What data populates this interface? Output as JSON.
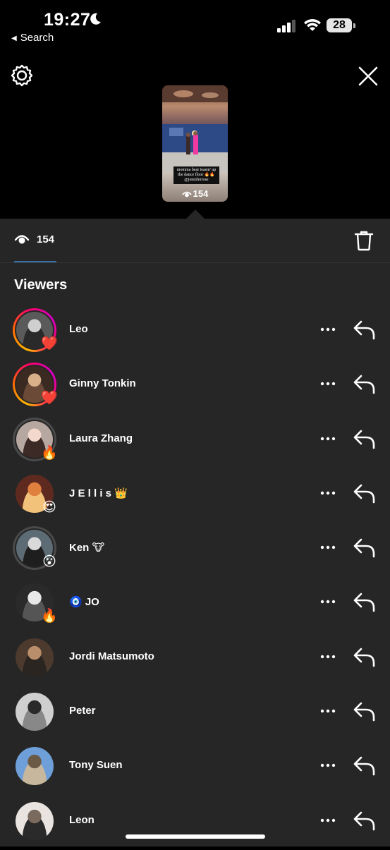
{
  "status": {
    "time": "19:27",
    "back_label": "Search",
    "battery": "28"
  },
  "story": {
    "caption": "momma bear teasin' up the dance floor 🔥🔥 @jenniferrose",
    "views": "154"
  },
  "tabs": {
    "views_count": "154"
  },
  "viewers": {
    "title": "Viewers",
    "items": [
      {
        "name": "Leo",
        "reaction": "❤️",
        "ring": "story"
      },
      {
        "name": "Ginny Tonkin",
        "reaction": "❤️",
        "ring": "story"
      },
      {
        "name": "Laura Zhang",
        "reaction": "🔥",
        "ring": "seen"
      },
      {
        "name": "J E l l i s 👑",
        "reaction": "😍",
        "ring": "none"
      },
      {
        "name": "Ken 🐮",
        "reaction": "😮",
        "ring": "seen"
      },
      {
        "name": "🧿 JO",
        "reaction": "🔥",
        "ring": "none"
      },
      {
        "name": "Jordi Matsumoto",
        "reaction": "",
        "ring": "none"
      },
      {
        "name": "Peter",
        "reaction": "",
        "ring": "none"
      },
      {
        "name": "Tony Suen",
        "reaction": "",
        "ring": "none"
      },
      {
        "name": "Leon",
        "reaction": "",
        "ring": "none"
      }
    ]
  },
  "icons": {
    "settings": "gear-icon",
    "close": "close-icon",
    "eye": "eye-icon",
    "delete": "trash-icon",
    "more": "more-dots-icon",
    "reply": "reply-arrow-icon"
  }
}
